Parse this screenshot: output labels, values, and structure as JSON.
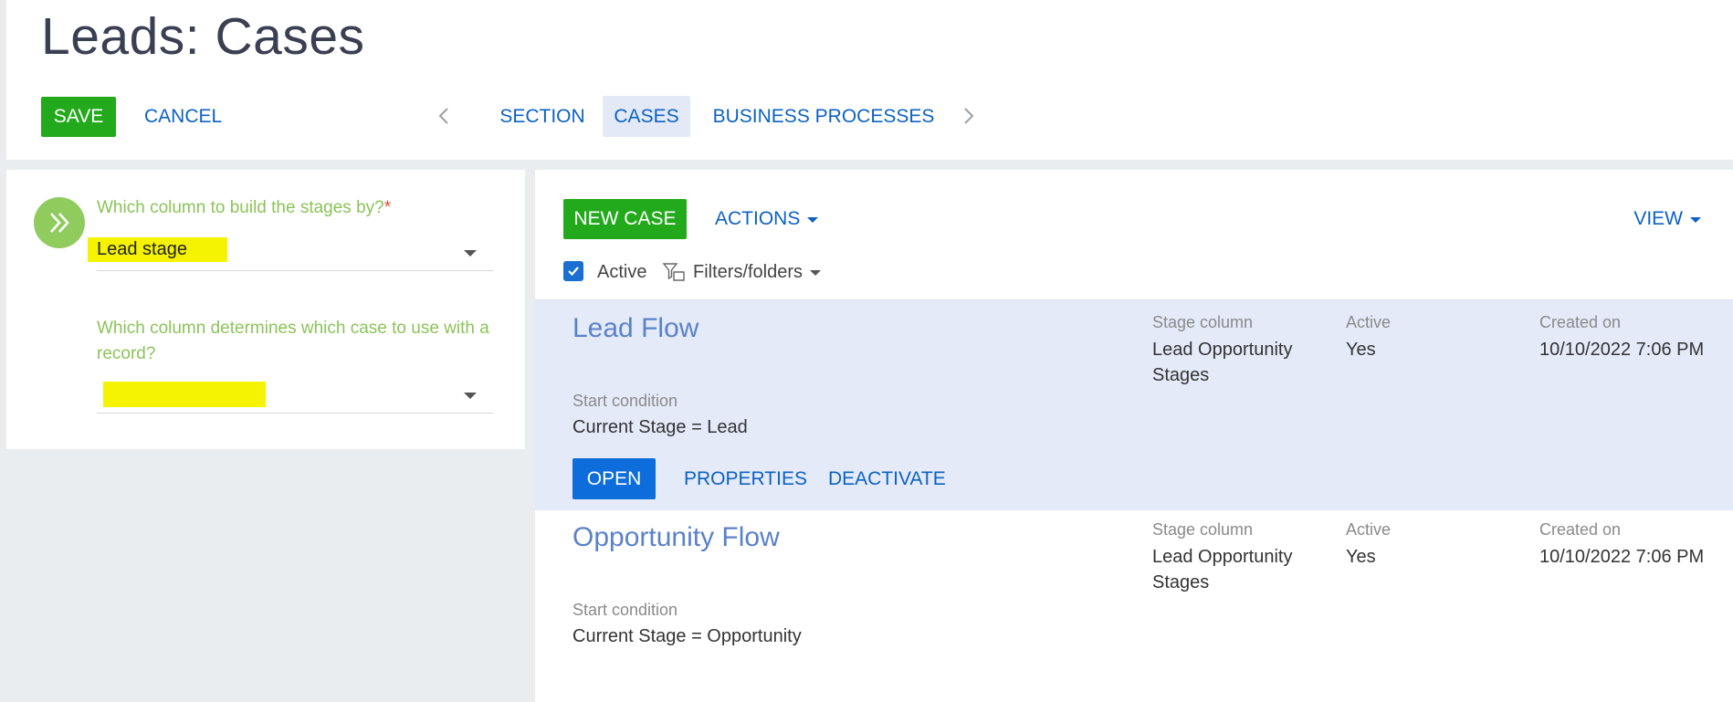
{
  "header": {
    "title": "Leads: Cases",
    "save_label": "SAVE",
    "cancel_label": "CANCEL",
    "tabs": [
      {
        "label": "SECTION"
      },
      {
        "label": "CASES"
      },
      {
        "label": "BUSINESS PROCESSES"
      }
    ],
    "active_tab": "CASES"
  },
  "settings": {
    "stage_question": "Which column to build the stages by?",
    "required_mark": "*",
    "stage_value": "Lead stage",
    "case_question": "Which column determines which case to use with a record?",
    "case_value": ""
  },
  "toolbar": {
    "new_case_label": "NEW CASE",
    "actions_label": "ACTIONS",
    "view_label": "VIEW",
    "active_checkbox_label": "Active",
    "active_checked": true,
    "filters_label": "Filters/folders"
  },
  "cases": [
    {
      "name": "Lead Flow",
      "stage_column_label": "Stage column",
      "stage_column_value_1": "Lead Opportunity",
      "stage_column_value_2": "Stages",
      "active_label": "Active",
      "active_value": "Yes",
      "created_label": "Created on",
      "created_value": "10/10/2022 7:06 PM",
      "start_condition_label": "Start condition",
      "start_condition_value": "Current Stage = Lead",
      "selected": true,
      "open_label": "OPEN",
      "properties_label": "PROPERTIES",
      "deactivate_label": "DEACTIVATE"
    },
    {
      "name": "Opportunity Flow",
      "stage_column_label": "Stage column",
      "stage_column_value_1": "Lead Opportunity",
      "stage_column_value_2": "Stages",
      "active_label": "Active",
      "active_value": "Yes",
      "created_label": "Created on",
      "created_value": "10/10/2022 7:06 PM",
      "start_condition_label": "Start condition",
      "start_condition_value": "Current Stage = Opportunity",
      "selected": false
    }
  ],
  "colors": {
    "primary_green": "#23a91c",
    "link_blue": "#0d62c2",
    "label_green": "#8cc35a",
    "highlight_yellow": "#f6f300",
    "selected_row": "#e4eaf8"
  }
}
